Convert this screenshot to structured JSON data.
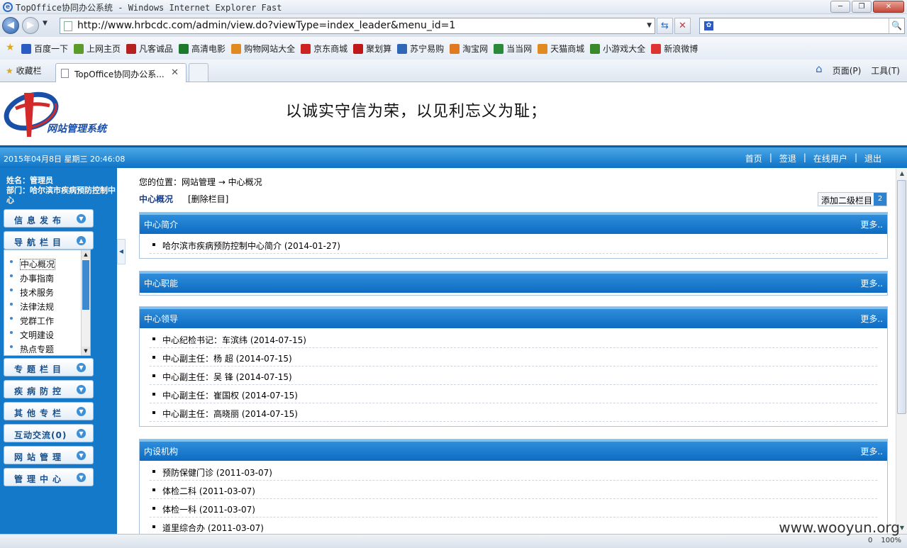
{
  "window": {
    "title": "TopOffice协同办公系统  - Windows Internet Explorer Fast",
    "minimize": "─",
    "restore": "❐",
    "close": "✕"
  },
  "browser": {
    "back": "◀",
    "forward": "▶",
    "dropdown": "▼",
    "url": "http://www.hrbcdc.com/admin/view.do?viewType=index_leader&menu_id=1",
    "refresh": "⇆",
    "stop": "✕",
    "search_placeholder": "",
    "search_go": "🔍"
  },
  "favorites_bar": {
    "links": [
      {
        "label": "百度一下",
        "color": "#2b5cc4"
      },
      {
        "label": "上网主页",
        "color": "#5a9b2a"
      },
      {
        "label": "凡客诚品",
        "color": "#b52020"
      },
      {
        "label": "高清电影",
        "color": "#1d7a2a"
      },
      {
        "label": "购物网站大全",
        "color": "#e08a20"
      },
      {
        "label": "京东商城",
        "color": "#cc2222"
      },
      {
        "label": "聚划算",
        "color": "#c01818"
      },
      {
        "label": "苏宁易购",
        "color": "#2f66b5"
      },
      {
        "label": "淘宝网",
        "color": "#e07a20"
      },
      {
        "label": "当当网",
        "color": "#2a8a3a"
      },
      {
        "label": "天猫商城",
        "color": "#e08a20"
      },
      {
        "label": "小游戏大全",
        "color": "#3a8a2a"
      },
      {
        "label": "新浪微博",
        "color": "#d33"
      }
    ]
  },
  "tabs_bar": {
    "favorites_label": "收藏栏",
    "tab_title": "TopOffice协同办公系...",
    "tab_close": "✕",
    "home_icon": "⌂",
    "page_menu": "页面(P)",
    "tools_menu": "工具(T)"
  },
  "header": {
    "logo_text": "网站管理系统",
    "slogan": "以诚实守信为荣，以见利忘义为耻；"
  },
  "topbar": {
    "datetime": "2015年04月8日 星期三 20:46:08",
    "links": [
      "首页",
      "签退",
      "在线用户",
      "退出"
    ],
    "separator": "|"
  },
  "sidebar": {
    "user_name": "姓名：管理员",
    "department": "部门：哈尔滨市疾病预防控制中心",
    "menus_top": [
      {
        "label": "信息发布"
      },
      {
        "label": "导航栏目"
      }
    ],
    "submenu": [
      "中心概况",
      "办事指南",
      "技术服务",
      "法律法规",
      "党群工作",
      "文明建设",
      "热点专题"
    ],
    "menus_bottom": [
      {
        "label": "专题栏目"
      },
      {
        "label": "疾病防控"
      },
      {
        "label": "其他专栏"
      },
      {
        "label": "互动交流(0)"
      },
      {
        "label": "网站管理"
      },
      {
        "label": "管理中心"
      }
    ],
    "expand_icon": "▲",
    "collapse_icon": "▼",
    "scroll_up": "▲",
    "scroll_down": "▼",
    "toggle_arrow": "◀"
  },
  "main": {
    "breadcrumb": "您的位置：网站管理 → 中心概况",
    "section_title": "中心概况",
    "delete_column": "[删除栏目]",
    "add_sub_column": "添加二级栏目",
    "add_sub_count": "2",
    "more_label": "更多..",
    "panels": [
      {
        "title": "中心简介",
        "items": [
          "哈尔滨市疾病预防控制中心简介 (2014-01-27)"
        ]
      },
      {
        "title": "中心职能",
        "items": []
      },
      {
        "title": "中心领导",
        "items": [
          "中心纪检书记：车滨纬 (2014-07-15)",
          "中心副主任：杨 超 (2014-07-15)",
          "中心副主任：吴 锋 (2014-07-15)",
          "中心副主任：崔国权 (2014-07-15)",
          "中心副主任：高晓丽 (2014-07-15)"
        ]
      },
      {
        "title": "内设机构",
        "items": [
          "预防保健门诊 (2011-03-07)",
          "体检二科 (2011-03-07)",
          "体检一科 (2011-03-07)",
          "道里综合办 (2011-03-07)"
        ]
      }
    ]
  },
  "scroll": {
    "up": "▲",
    "down": "▼"
  },
  "statusbar": {
    "items": [
      "0",
      "100%"
    ]
  },
  "watermark": "www.wooyun.org"
}
